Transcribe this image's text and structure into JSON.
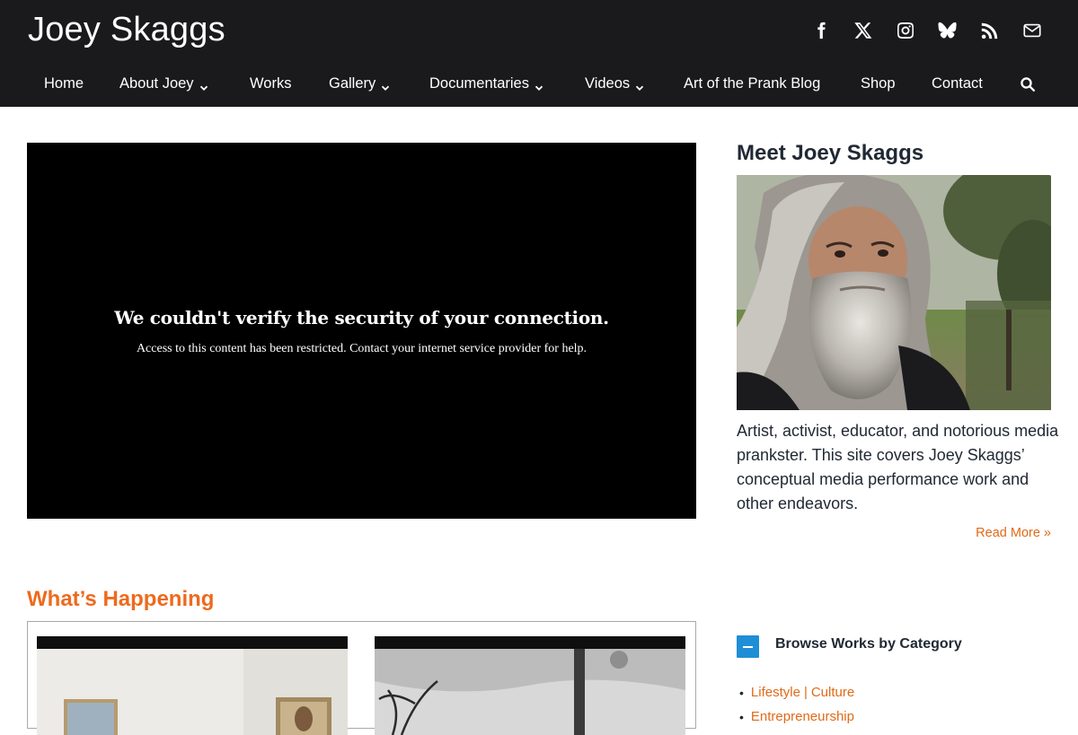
{
  "site": {
    "title": "Joey Skaggs"
  },
  "social": [
    "facebook-icon",
    "x-icon",
    "instagram-icon",
    "bluesky-icon",
    "rss-icon",
    "mail-icon"
  ],
  "nav": [
    {
      "label": "Home",
      "dropdown": false
    },
    {
      "label": "About Joey",
      "dropdown": true
    },
    {
      "label": "Works",
      "dropdown": false
    },
    {
      "label": "Gallery",
      "dropdown": true
    },
    {
      "label": "Documentaries",
      "dropdown": true
    },
    {
      "label": "Videos",
      "dropdown": true
    },
    {
      "label": "Art of the Prank Blog",
      "dropdown": false
    },
    {
      "label": "Shop",
      "dropdown": false
    },
    {
      "label": "Contact",
      "dropdown": false
    }
  ],
  "video": {
    "title": "We couldn't verify the security of your connection.",
    "message": "Access to this content has been restricted. Contact your internet service provider for help."
  },
  "sidebar": {
    "meet_title": "Meet Joey Skaggs",
    "bio": "Artist, activist, educator, and notorious media prankster. This site covers Joey Skaggs’ conceptual media performance work and other endeavors.",
    "read_more": "Read More »"
  },
  "happening": {
    "title": "What’s Happening"
  },
  "browse": {
    "title": "Browse Works by Category",
    "categories": [
      {
        "parts": [
          "Lifestyle",
          "Culture"
        ]
      },
      {
        "parts": [
          "Entrepreneurship"
        ]
      }
    ]
  },
  "colors": {
    "accent": "#ee6a1e",
    "link": "#e06a18",
    "header_bg": "#1a1a1c",
    "toggle": "#1e8fd6"
  }
}
